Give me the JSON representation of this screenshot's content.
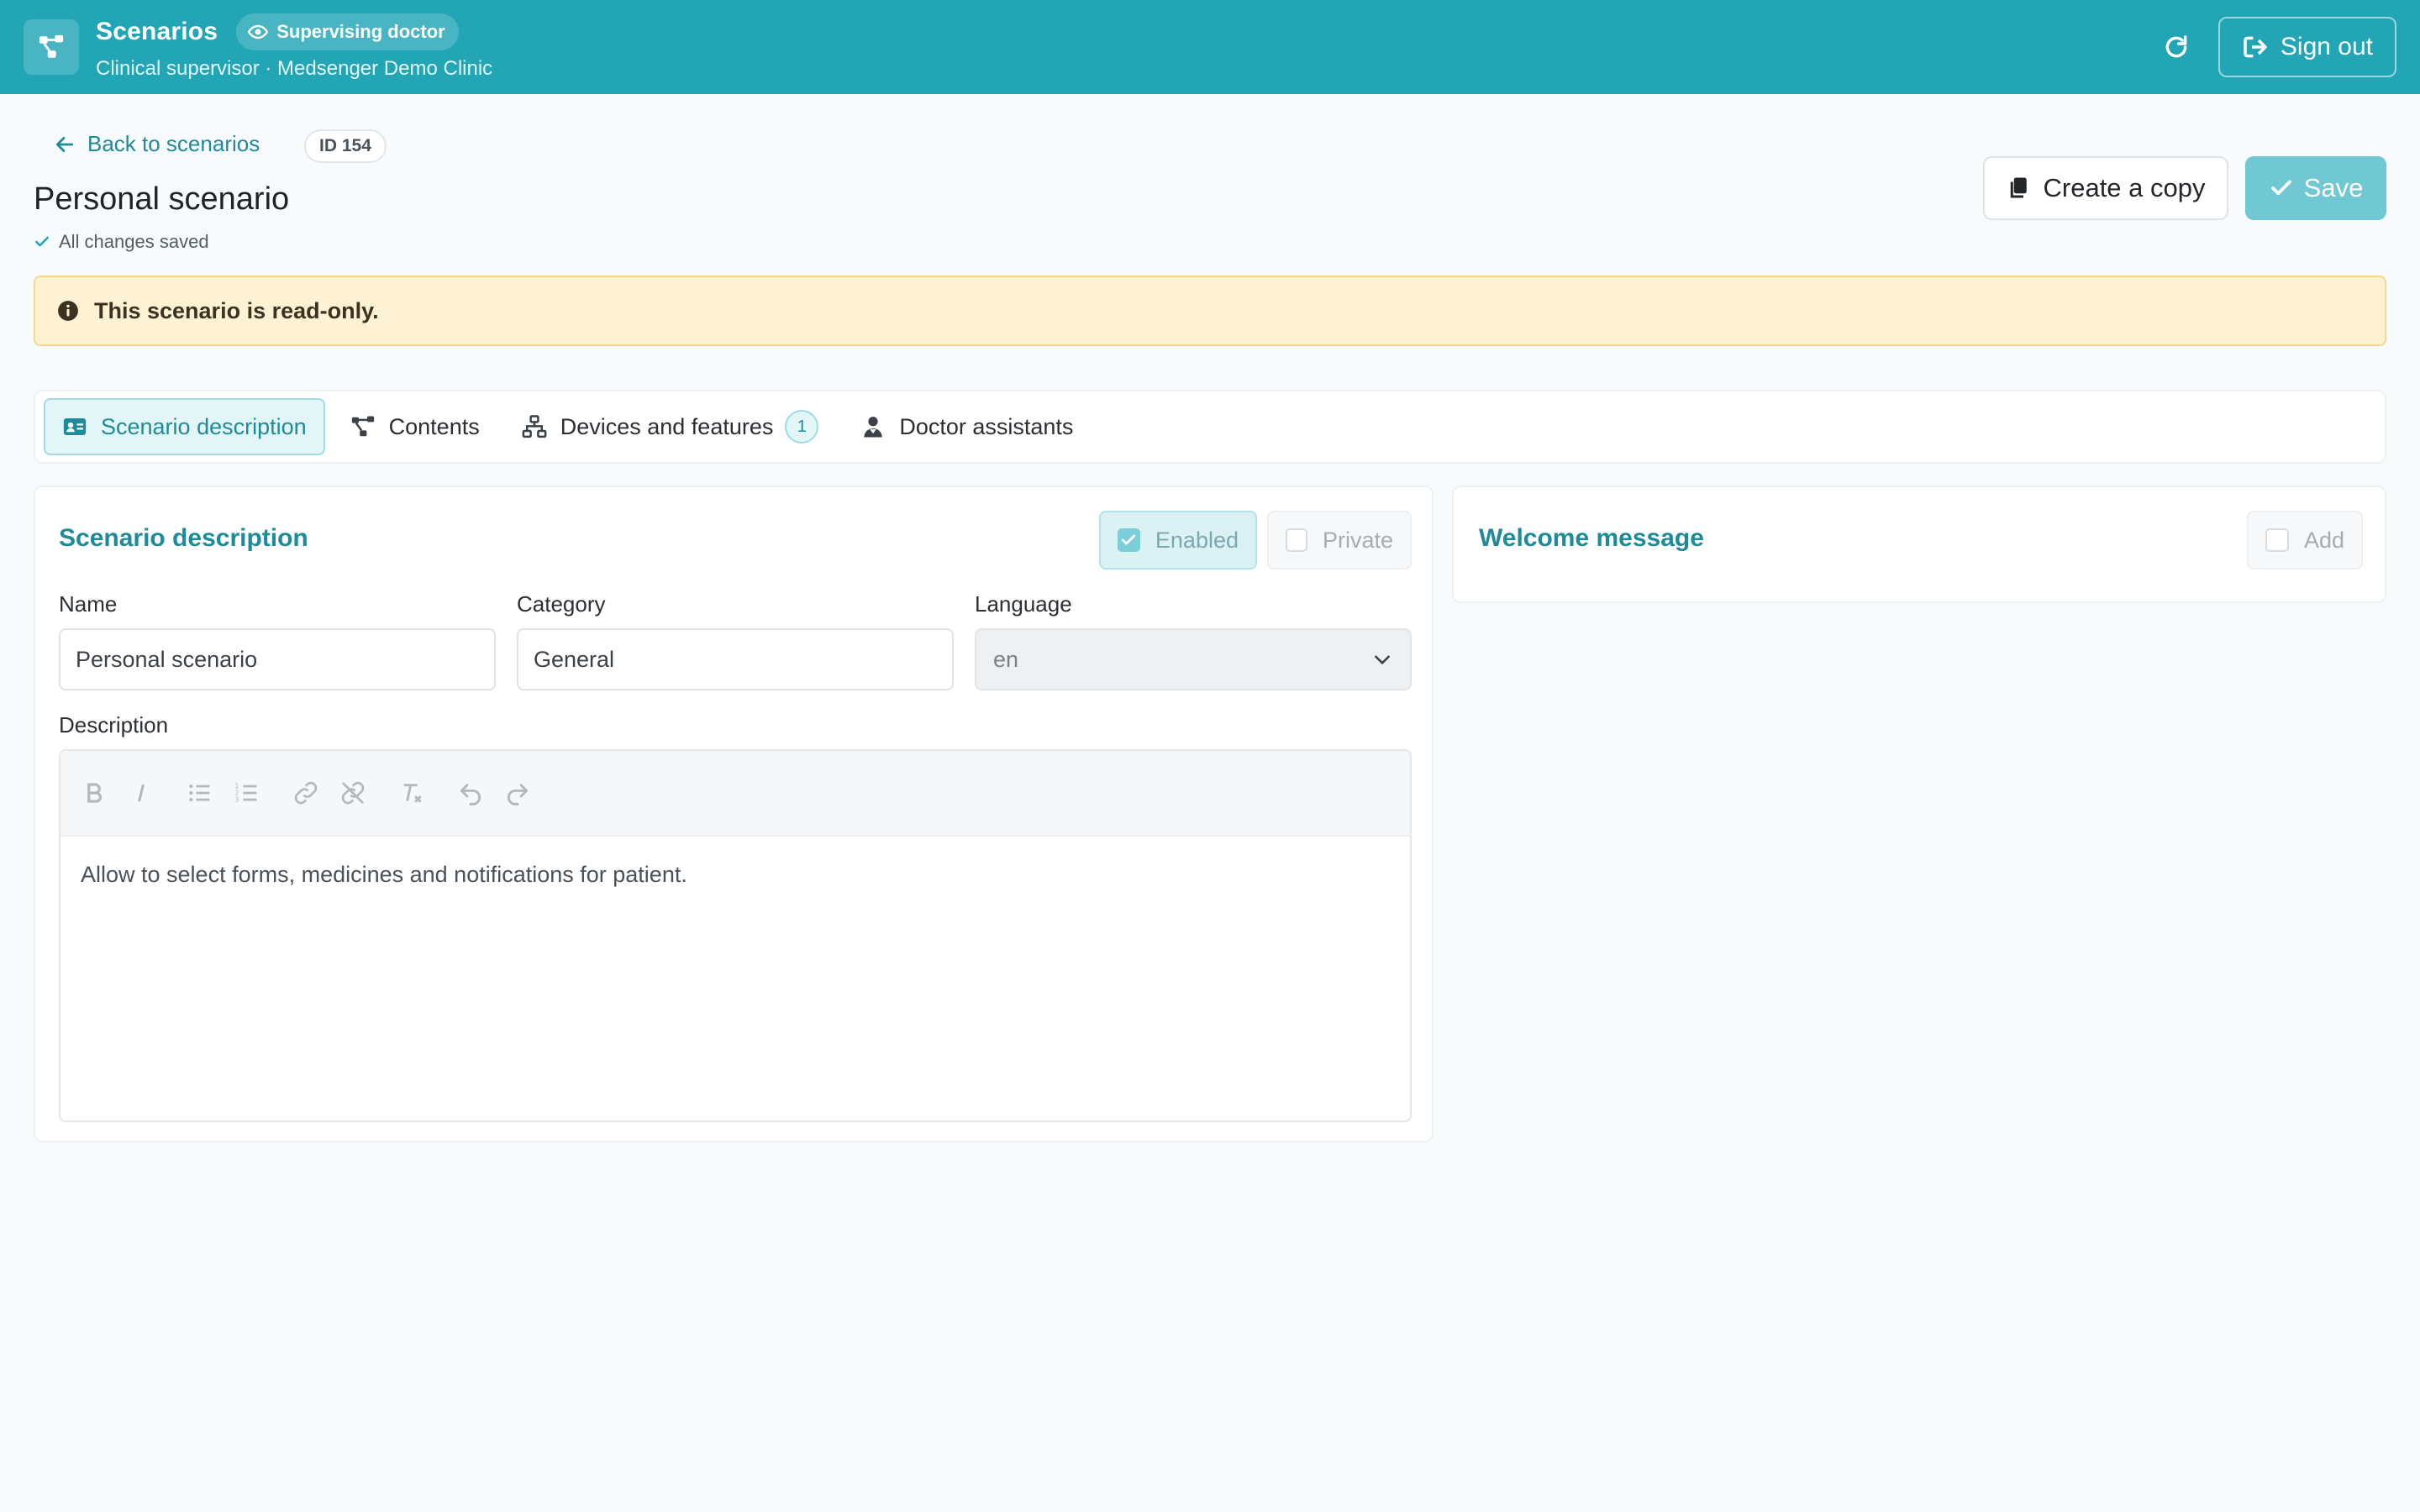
{
  "topbar": {
    "title": "Scenarios",
    "role_badge": "Supervising doctor",
    "subtitle": "Clinical supervisor · Medsenger Demo Clinic",
    "sign_out": "Sign out"
  },
  "header": {
    "back_label": "Back to scenarios",
    "id_badge": "ID 154",
    "title": "Personal scenario",
    "save_status": "All changes saved",
    "copy_button": "Create a copy",
    "save_button": "Save"
  },
  "alert": {
    "text": "This scenario is read-only."
  },
  "tabs": [
    {
      "label": "Scenario description",
      "icon": "id-card-icon",
      "active": true
    },
    {
      "label": "Contents",
      "icon": "graph-icon",
      "active": false
    },
    {
      "label": "Devices and features",
      "icon": "network-icon",
      "active": false,
      "count": "1"
    },
    {
      "label": "Doctor assistants",
      "icon": "doctor-icon",
      "active": false
    }
  ],
  "description_card": {
    "title": "Scenario description",
    "enabled_label": "Enabled",
    "enabled_checked": true,
    "private_label": "Private",
    "private_checked": false,
    "name_label": "Name",
    "name_value": "Personal scenario",
    "category_label": "Category",
    "category_value": "General",
    "language_label": "Language",
    "language_value": "en",
    "description_label": "Description",
    "description_text": "Allow to select forms, medicines and notifications for patient."
  },
  "welcome_card": {
    "title": "Welcome message",
    "add_label": "Add",
    "add_checked": false
  },
  "colors": {
    "brand": "#22a5b5",
    "accent_text": "#1f8a99",
    "alert_bg": "#fff2d4",
    "save_button": "#6fc8d2"
  }
}
